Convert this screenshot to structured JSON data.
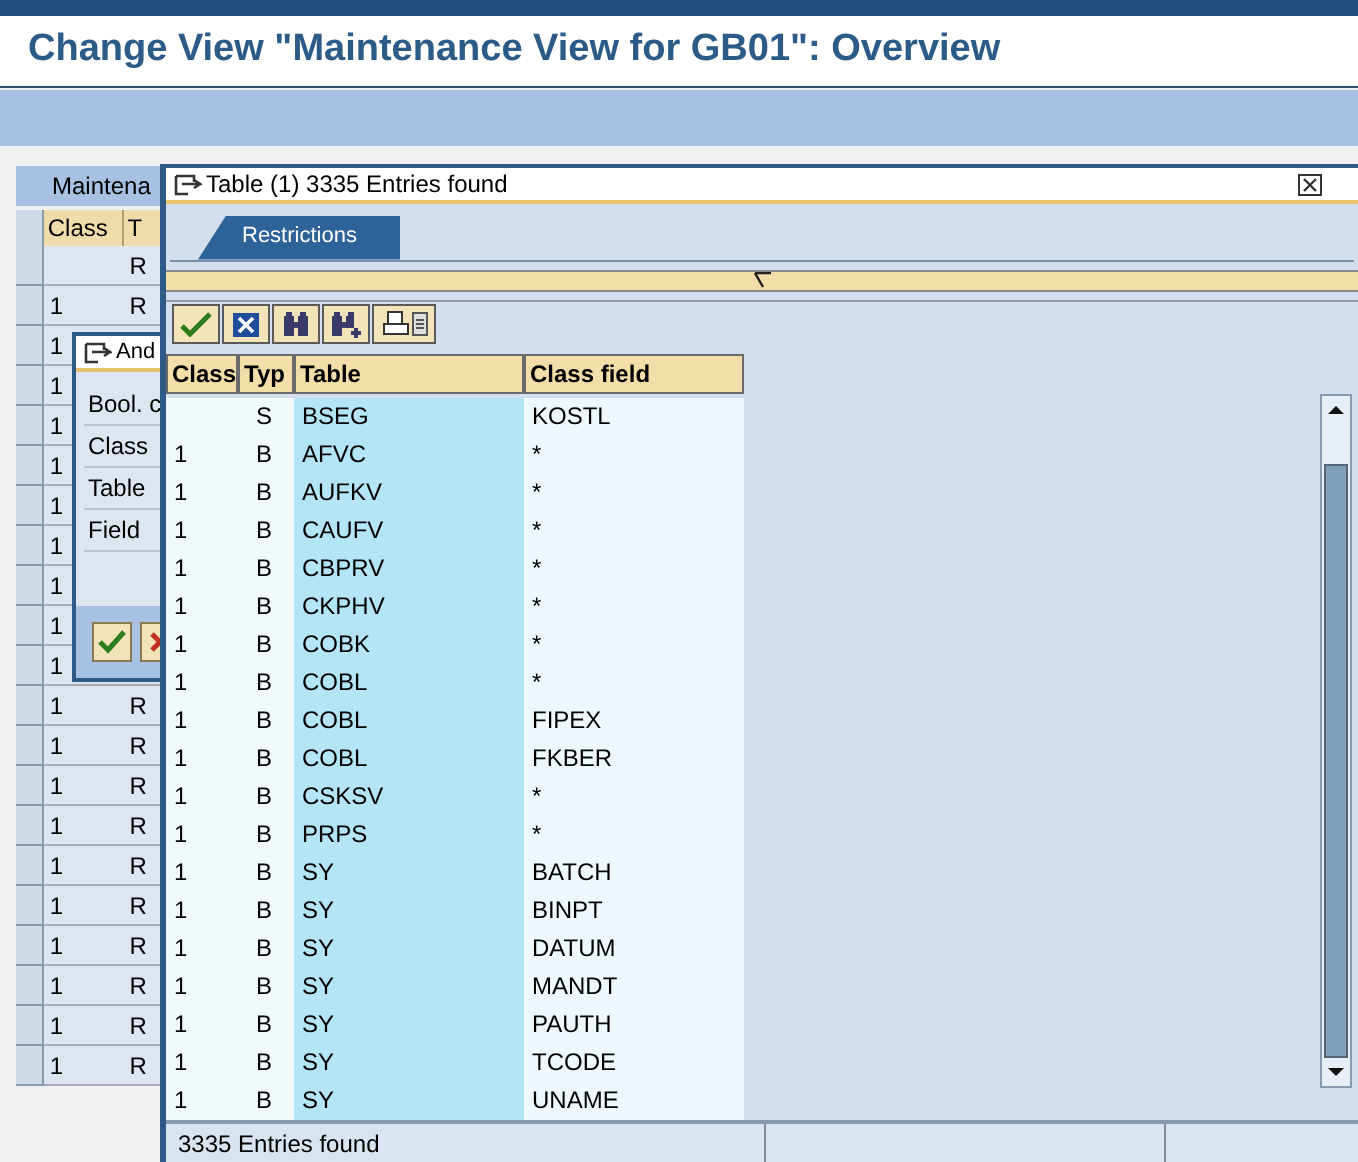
{
  "title": "Change View \"Maintenance View for GB01\": Overview",
  "background_table": {
    "heading": "Maintena",
    "columns": [
      "Class",
      "T"
    ],
    "rows": [
      {
        "type": "R"
      },
      {
        "class": "1",
        "type": "R"
      },
      {
        "class": "1"
      },
      {
        "class": "1"
      },
      {
        "class": "1"
      },
      {
        "class": "1"
      },
      {
        "class": "1"
      },
      {
        "class": "1"
      },
      {
        "class": "1"
      },
      {
        "class": "1"
      },
      {
        "class": "1"
      },
      {
        "class": "1",
        "type": "R"
      },
      {
        "class": "1",
        "type": "R"
      },
      {
        "class": "1",
        "type": "R"
      },
      {
        "class": "1",
        "type": "R"
      },
      {
        "class": "1",
        "type": "R"
      },
      {
        "class": "1",
        "type": "R"
      },
      {
        "class": "1",
        "type": "R"
      },
      {
        "class": "1",
        "type": "R"
      },
      {
        "class": "1",
        "type": "R"
      },
      {
        "class": "1",
        "type": "R"
      }
    ]
  },
  "dialog": {
    "title": "And",
    "fields": [
      "Bool. c",
      "Class",
      "Table",
      "Field"
    ]
  },
  "popup": {
    "title": "Table (1) 3335 Entries found",
    "tabs": [
      {
        "label": "Restrictions",
        "selected": true
      }
    ],
    "columns": [
      "Class",
      "Typ",
      "Table",
      "Class field"
    ],
    "rows": [
      {
        "typ": "S",
        "table": "BSEG",
        "field": "KOSTL"
      },
      {
        "class": "1",
        "typ": "B",
        "table": "AFVC",
        "field": "*"
      },
      {
        "class": "1",
        "typ": "B",
        "table": "AUFKV",
        "field": "*"
      },
      {
        "class": "1",
        "typ": "B",
        "table": "CAUFV",
        "field": "*"
      },
      {
        "class": "1",
        "typ": "B",
        "table": "CBPRV",
        "field": "*"
      },
      {
        "class": "1",
        "typ": "B",
        "table": "CKPHV",
        "field": "*"
      },
      {
        "class": "1",
        "typ": "B",
        "table": "COBK",
        "field": "*"
      },
      {
        "class": "1",
        "typ": "B",
        "table": "COBL",
        "field": "*"
      },
      {
        "class": "1",
        "typ": "B",
        "table": "COBL",
        "field": "FIPEX"
      },
      {
        "class": "1",
        "typ": "B",
        "table": "COBL",
        "field": "FKBER"
      },
      {
        "class": "1",
        "typ": "B",
        "table": "CSKSV",
        "field": "*"
      },
      {
        "class": "1",
        "typ": "B",
        "table": "PRPS",
        "field": "*"
      },
      {
        "class": "1",
        "typ": "B",
        "table": "SY",
        "field": "BATCH"
      },
      {
        "class": "1",
        "typ": "B",
        "table": "SY",
        "field": "BINPT"
      },
      {
        "class": "1",
        "typ": "B",
        "table": "SY",
        "field": "DATUM"
      },
      {
        "class": "1",
        "typ": "B",
        "table": "SY",
        "field": "MANDT"
      },
      {
        "class": "1",
        "typ": "B",
        "table": "SY",
        "field": "PAUTH"
      },
      {
        "class": "1",
        "typ": "B",
        "table": "SY",
        "field": "TCODE"
      },
      {
        "class": "1",
        "typ": "B",
        "table": "SY",
        "field": "UNAME"
      }
    ],
    "status": "3335 Entries found"
  }
}
